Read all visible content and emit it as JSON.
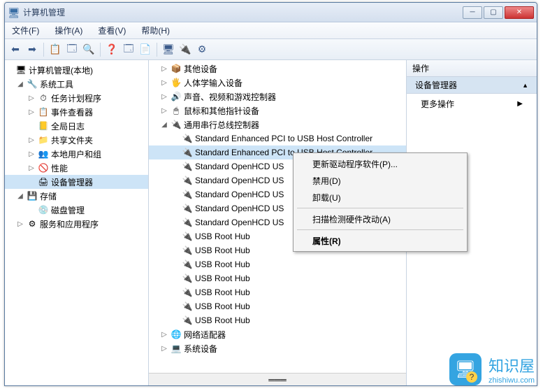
{
  "window": {
    "title": "计算机管理"
  },
  "menubar": [
    "文件(F)",
    "操作(A)",
    "查看(V)",
    "帮助(H)"
  ],
  "win_btns": {
    "min": "─",
    "max": "▢",
    "close": "✕"
  },
  "left_tree": {
    "root": {
      "label": "计算机管理(本地)",
      "icon": "🖥"
    },
    "sys_tools": {
      "label": "系统工具",
      "icon": "🔧"
    },
    "sys_children": [
      {
        "label": "任务计划程序",
        "icon": "⏱",
        "exp": "▷"
      },
      {
        "label": "事件查看器",
        "icon": "📋",
        "exp": "▷"
      },
      {
        "label": "全局日志",
        "icon": "📒",
        "exp": ""
      },
      {
        "label": "共享文件夹",
        "icon": "📁",
        "exp": "▷"
      },
      {
        "label": "本地用户和组",
        "icon": "👥",
        "exp": "▷"
      },
      {
        "label": "性能",
        "icon": "🚫",
        "exp": "▷"
      },
      {
        "label": "设备管理器",
        "icon": "🖨",
        "exp": "",
        "sel": true
      }
    ],
    "storage": {
      "label": "存储",
      "icon": "💾"
    },
    "storage_children": [
      {
        "label": "磁盘管理",
        "icon": "💿"
      }
    ],
    "services": {
      "label": "服务和应用程序",
      "icon": "⚙"
    }
  },
  "mid_tree": {
    "top": [
      {
        "label": "其他设备",
        "icon": "📦",
        "exp": "▷",
        "indent": 1
      },
      {
        "label": "人体学输入设备",
        "icon": "🖐",
        "exp": "▷",
        "indent": 1
      },
      {
        "label": "声音、视频和游戏控制器",
        "icon": "🔊",
        "exp": "▷",
        "indent": 1
      },
      {
        "label": "鼠标和其他指针设备",
        "icon": "🖱",
        "exp": "▷",
        "indent": 1
      }
    ],
    "usb_header": {
      "label": "通用串行总线控制器",
      "icon": "🔌",
      "exp": "◢",
      "indent": 1
    },
    "usb_items": [
      {
        "label": "Standard Enhanced PCI to USB Host Controller",
        "sel": false
      },
      {
        "label": "Standard Enhanced PCI to USB Host Controller",
        "sel": true
      },
      {
        "label": "Standard OpenHCD US",
        "sel": false
      },
      {
        "label": "Standard OpenHCD US",
        "sel": false
      },
      {
        "label": "Standard OpenHCD US",
        "sel": false
      },
      {
        "label": "Standard OpenHCD US",
        "sel": false
      },
      {
        "label": "Standard OpenHCD US",
        "sel": false
      },
      {
        "label": "USB Root Hub",
        "sel": false
      },
      {
        "label": "USB Root Hub",
        "sel": false
      },
      {
        "label": "USB Root Hub",
        "sel": false
      },
      {
        "label": "USB Root Hub",
        "sel": false
      },
      {
        "label": "USB Root Hub",
        "sel": false
      },
      {
        "label": "USB Root Hub",
        "sel": false
      },
      {
        "label": "USB Root Hub",
        "sel": false
      }
    ],
    "bottom": [
      {
        "label": "网络适配器",
        "icon": "🌐",
        "exp": "▷",
        "indent": 1
      },
      {
        "label": "系统设备",
        "icon": "💻",
        "exp": "▷",
        "indent": 1
      }
    ]
  },
  "right": {
    "header": "操作",
    "selected": "设备管理器",
    "more": "更多操作"
  },
  "context_menu": [
    "更新驱动程序软件(P)...",
    "禁用(D)",
    "卸载(U)",
    "-",
    "扫描检测硬件改动(A)",
    "-",
    "属性(R)"
  ],
  "watermark": {
    "text": "知识屋",
    "sub": "zhishiwu.com"
  }
}
